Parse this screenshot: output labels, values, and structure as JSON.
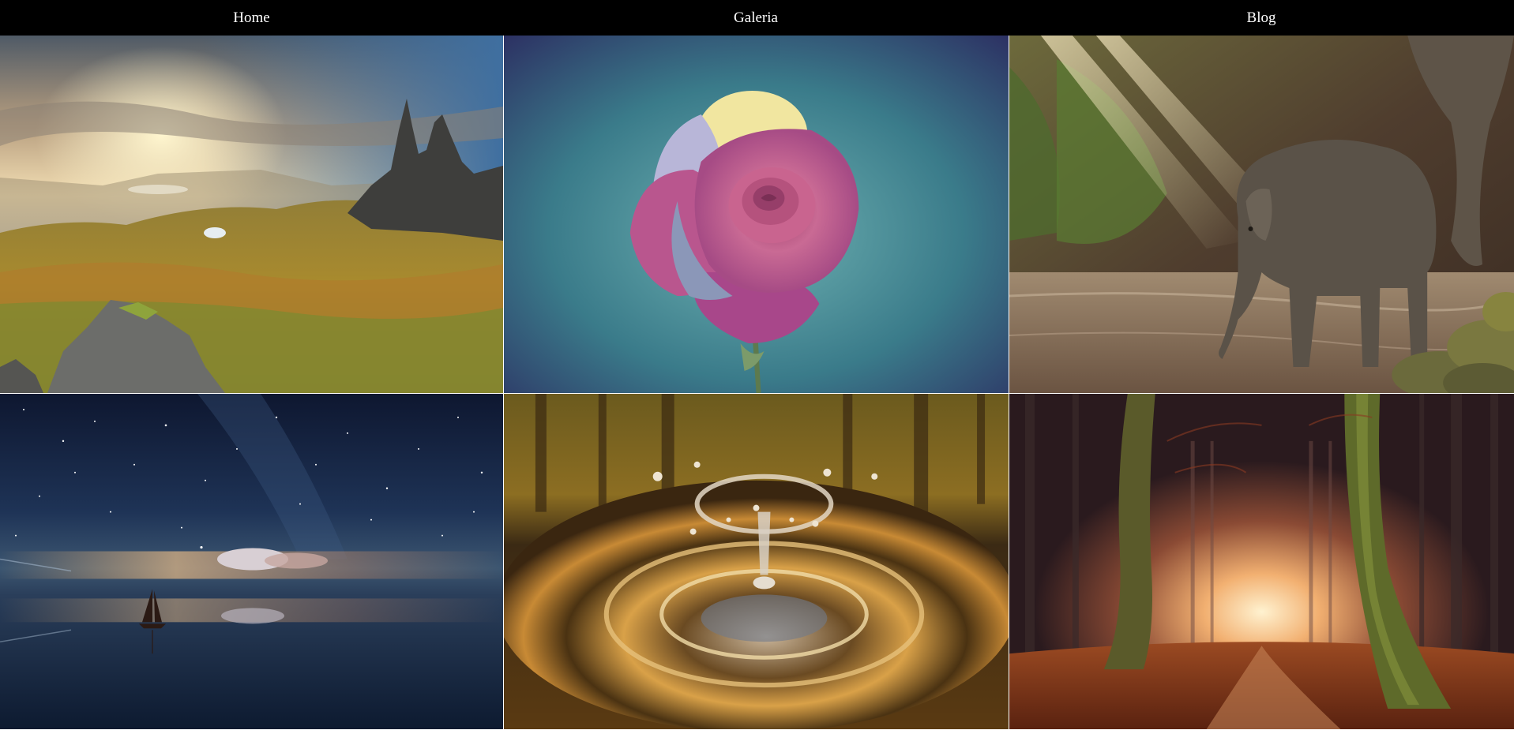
{
  "nav": {
    "items": [
      {
        "label": "Home"
      },
      {
        "label": "Galeria"
      },
      {
        "label": "Blog"
      }
    ]
  },
  "gallery": {
    "images": [
      {
        "subject": "mountain-landscape"
      },
      {
        "subject": "rose-with-dew"
      },
      {
        "subject": "baby-elephant-in-river"
      },
      {
        "subject": "sailboat-under-starry-sky"
      },
      {
        "subject": "water-drop-splash"
      },
      {
        "subject": "autumn-forest-path"
      }
    ]
  },
  "colors": {
    "nav_background": "#000000",
    "nav_text": "#ffffff"
  }
}
